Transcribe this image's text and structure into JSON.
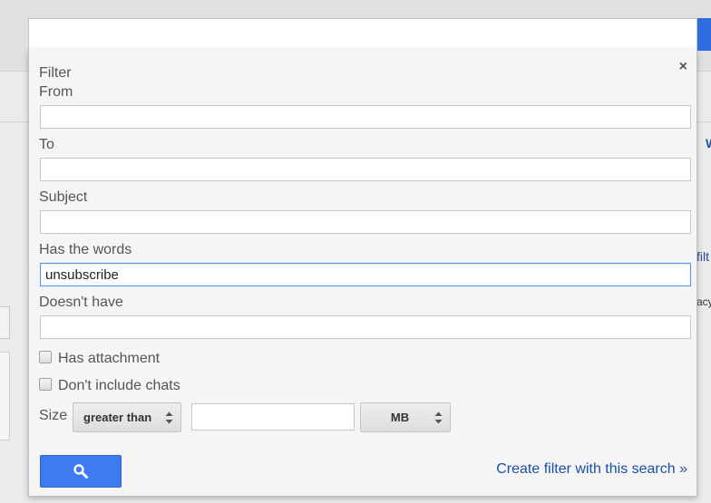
{
  "background": {
    "partial_text_1": "W",
    "partial_text_2": "filt",
    "partial_text_3": "acy"
  },
  "dialog": {
    "title": "Filter",
    "close_glyph": "×",
    "fields": {
      "from": {
        "label": "From",
        "value": ""
      },
      "to": {
        "label": "To",
        "value": ""
      },
      "subject": {
        "label": "Subject",
        "value": ""
      },
      "has_words": {
        "label": "Has the words",
        "value": "unsubscribe"
      },
      "doesnt_have": {
        "label": "Doesn't have",
        "value": ""
      }
    },
    "checkboxes": {
      "has_attachment": {
        "label": "Has attachment",
        "checked": false
      },
      "dont_include_chats": {
        "label": "Don't include chats",
        "checked": false
      }
    },
    "size": {
      "label": "Size",
      "comparator": "greater than",
      "value": "",
      "unit": "MB"
    },
    "search_icon": "search-icon",
    "create_filter_link": "Create filter with this search »"
  },
  "colors": {
    "accent_blue": "#3d7cf0",
    "link_blue": "#1a4faa",
    "focus_border": "#4d90fe"
  }
}
